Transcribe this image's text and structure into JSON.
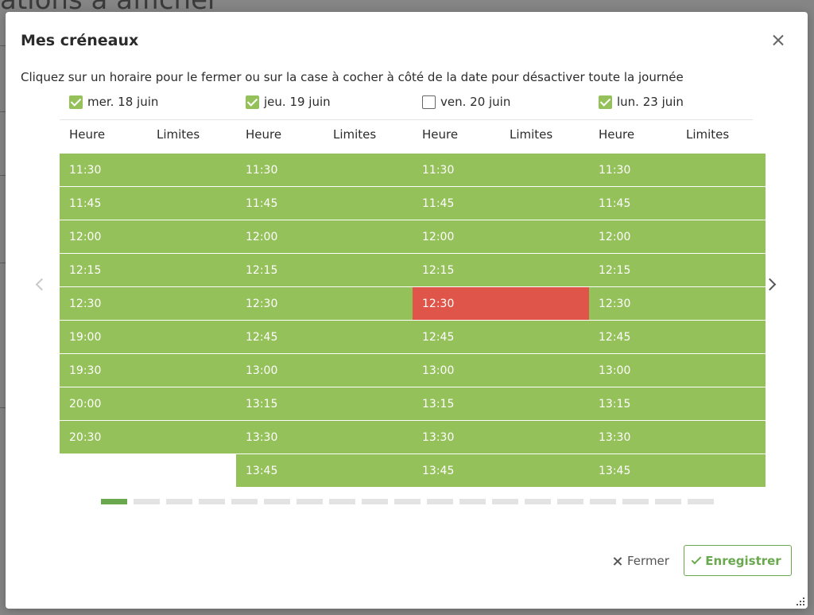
{
  "background": {
    "title_fragment": "ations à afficher"
  },
  "modal": {
    "title": "Mes créneaux",
    "instructions": "Cliquez sur un horaire pour le fermer ou sur la case à cocher à côté de la date pour désactiver toute la journée",
    "days": [
      {
        "label": "mer. 18 juin",
        "checked": true,
        "slots": [
          "11:30",
          "11:45",
          "12:00",
          "12:15",
          "12:30",
          "19:00",
          "19:30",
          "20:00",
          "20:30"
        ],
        "closed_slots": []
      },
      {
        "label": "jeu. 19 juin",
        "checked": true,
        "slots": [
          "11:30",
          "11:45",
          "12:00",
          "12:15",
          "12:30",
          "12:45",
          "13:00",
          "13:15",
          "13:30",
          "13:45"
        ],
        "closed_slots": []
      },
      {
        "label": "ven. 20 juin",
        "checked": false,
        "slots": [
          "11:30",
          "11:45",
          "12:00",
          "12:15",
          "12:30",
          "12:45",
          "13:00",
          "13:15",
          "13:30",
          "13:45"
        ],
        "closed_slots": [
          "12:30"
        ]
      },
      {
        "label": "lun. 23 juin",
        "checked": true,
        "slots": [
          "11:30",
          "11:45",
          "12:00",
          "12:15",
          "12:30",
          "12:45",
          "13:00",
          "13:15",
          "13:30",
          "13:45"
        ],
        "closed_slots": []
      }
    ],
    "column_headers": {
      "hour": "Heure",
      "limits": "Limites"
    },
    "pagination": {
      "pages": 19,
      "active_page": 1
    },
    "buttons": {
      "close": "Fermer",
      "save": "Enregistrer"
    }
  },
  "colors": {
    "open_slot": "#95c15b",
    "closed_slot": "#e0554a",
    "accent": "#6aa84f"
  },
  "icons": {
    "close": "close-icon",
    "prev": "chevron-left-icon",
    "next": "chevron-right-icon",
    "save": "check-icon",
    "resize": "resize-handle-icon"
  }
}
